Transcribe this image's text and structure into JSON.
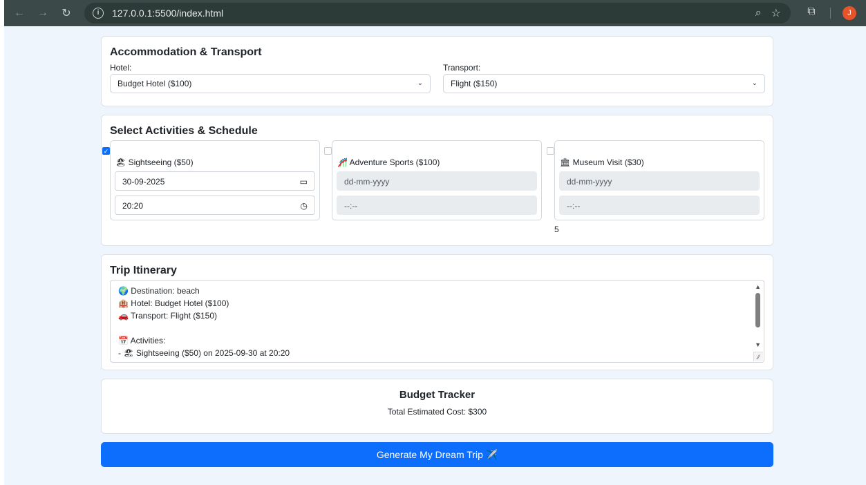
{
  "browser": {
    "url": "127.0.0.1:5500/index.html",
    "avatar_letter": "J"
  },
  "accommodation": {
    "title": "Accommodation & Transport",
    "hotel_label": "Hotel:",
    "hotel_value": "Budget Hotel ($100)",
    "transport_label": "Transport:",
    "transport_value": "Flight ($150)"
  },
  "activities": {
    "title": "Select Activities & Schedule",
    "items": [
      {
        "icon": "🏖",
        "label": "Sightseeing ($50)",
        "checked": true,
        "date": "30-09-2025",
        "time": "20:20"
      },
      {
        "icon": "🎢",
        "label": "Adventure Sports ($100)",
        "checked": false,
        "date": "dd-mm-yyyy",
        "time": "--:--"
      },
      {
        "icon": "🏛",
        "label": "Museum Visit ($30)",
        "checked": false,
        "date": "dd-mm-yyyy",
        "time": "--:--"
      }
    ],
    "count": "5"
  },
  "itinerary": {
    "title": "Trip Itinerary",
    "lines": [
      "🌍 Destination: beach",
      "🏨 Hotel: Budget Hotel ($100)",
      "🚗 Transport: Flight ($150)",
      "",
      "📅 Activities:",
      "- 🏖 Sightseeing ($50) on 2025-09-30 at 20:20"
    ]
  },
  "budget": {
    "title": "Budget Tracker",
    "total": "Total Estimated Cost: $300"
  },
  "generate_button": "Generate My Dream Trip ✈️",
  "colors": {
    "primary": "#0d6efd",
    "page_bg": "#eef5fc",
    "chrome_bg": "#3b4a48"
  }
}
